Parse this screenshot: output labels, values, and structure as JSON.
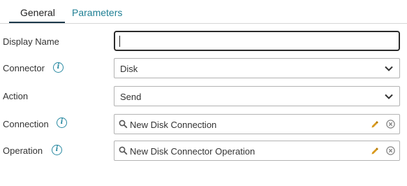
{
  "tabs": [
    {
      "label": "General",
      "active": true
    },
    {
      "label": "Parameters",
      "active": false
    }
  ],
  "form": {
    "display_name": {
      "label": "Display Name",
      "value": ""
    },
    "connector": {
      "label": "Connector",
      "value": "Disk",
      "info_icon": "info-icon"
    },
    "action": {
      "label": "Action",
      "value": "Send"
    },
    "connection": {
      "label": "Connection",
      "value": "New Disk Connection",
      "info_icon": "info-icon"
    },
    "operation": {
      "label": "Operation",
      "value": "New Disk Connector Operation",
      "info_icon": "info-icon"
    }
  },
  "colors": {
    "accent": "#1f7f94",
    "active_tab_underline": "#1e3a4c",
    "pencil": "#d99a1e",
    "border": "#b3b3b3"
  }
}
